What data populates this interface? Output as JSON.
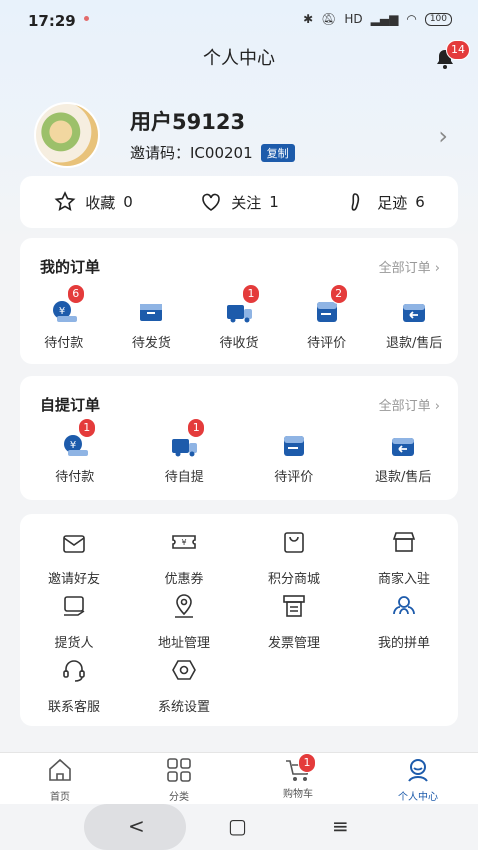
{
  "status": {
    "time": "17:29",
    "battery": "100",
    "signal": "HD"
  },
  "header": {
    "title": "个人中心",
    "bell_badge": "14"
  },
  "profile": {
    "username": "用户59123",
    "invite_label": "邀请码：IC00201",
    "copy_label": "复制"
  },
  "stats": [
    {
      "icon": "star-icon",
      "label": "收藏",
      "count": "0"
    },
    {
      "icon": "heart-icon",
      "label": "关注",
      "count": "1"
    },
    {
      "icon": "footprint-icon",
      "label": "足迹",
      "count": "6"
    }
  ],
  "my_orders": {
    "title": "我的订单",
    "more": "全部订单 ›",
    "items": [
      {
        "label": "待付款",
        "badge": "6",
        "icon": "wallet-icon"
      },
      {
        "label": "待发货",
        "badge": "",
        "icon": "box-icon"
      },
      {
        "label": "待收货",
        "badge": "1",
        "icon": "truck-icon"
      },
      {
        "label": "待评价",
        "badge": "2",
        "icon": "review-icon"
      },
      {
        "label": "退款/售后",
        "badge": "",
        "icon": "return-icon"
      }
    ]
  },
  "pickup_orders": {
    "title": "自提订单",
    "more": "全部订单 ›",
    "items": [
      {
        "label": "待付款",
        "badge": "1",
        "icon": "wallet-icon"
      },
      {
        "label": "待自提",
        "badge": "1",
        "icon": "truck-icon"
      },
      {
        "label": "待评价",
        "badge": "",
        "icon": "review-icon"
      },
      {
        "label": "退款/售后",
        "badge": "",
        "icon": "return-icon"
      }
    ]
  },
  "services": [
    {
      "label": "邀请好友",
      "icon": "envelope-icon"
    },
    {
      "label": "优惠券",
      "icon": "coupon-icon"
    },
    {
      "label": "积分商城",
      "icon": "bag-icon"
    },
    {
      "label": "商家入驻",
      "icon": "store-icon"
    },
    {
      "label": "提货人",
      "icon": "pickup-person-icon"
    },
    {
      "label": "地址管理",
      "icon": "location-icon"
    },
    {
      "label": "发票管理",
      "icon": "invoice-icon"
    },
    {
      "label": "我的拼单",
      "icon": "group-icon"
    },
    {
      "label": "联系客服",
      "icon": "headset-icon"
    },
    {
      "label": "系统设置",
      "icon": "settings-icon"
    }
  ],
  "tabs": [
    {
      "label": "首页",
      "icon": "home-icon"
    },
    {
      "label": "分类",
      "icon": "grid-icon"
    },
    {
      "label": "购物车",
      "icon": "cart-icon",
      "badge": "1"
    },
    {
      "label": "个人中心",
      "icon": "user-icon"
    }
  ],
  "nav": {
    "back": "<",
    "home": "▢",
    "menu": "≡"
  },
  "colors": {
    "accent": "#1d5bab",
    "badge": "#e43b3b"
  }
}
